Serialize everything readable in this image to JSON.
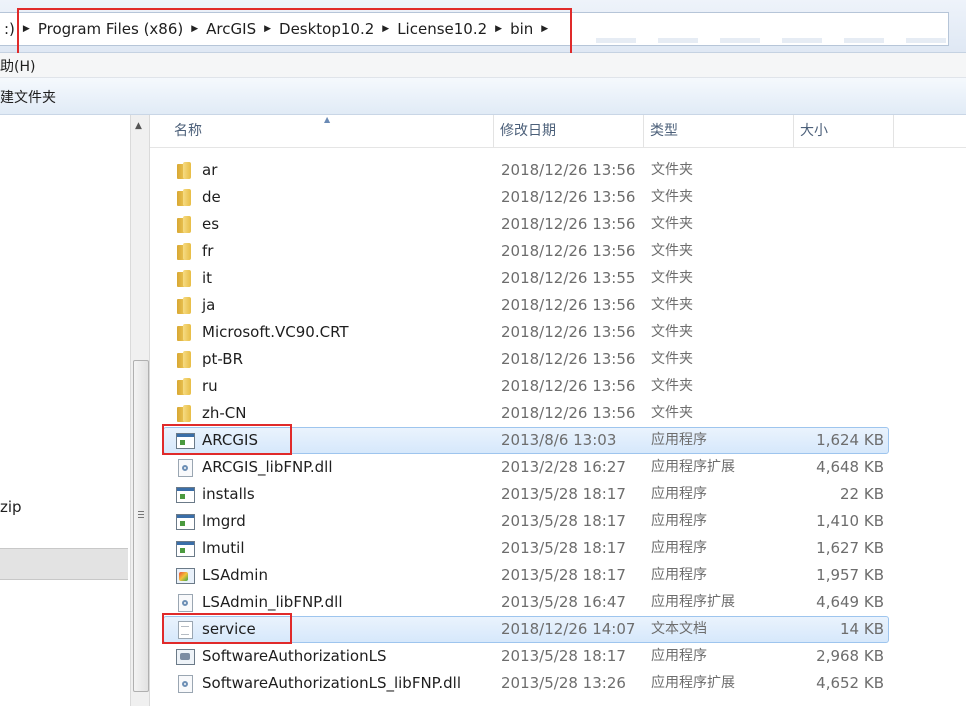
{
  "address": {
    "drive_fragment": ":)",
    "crumbs": [
      "Program Files (x86)",
      "ArcGIS",
      "Desktop10.2",
      "License10.2",
      "bin"
    ]
  },
  "menu": {
    "help_fragment": "助(H)"
  },
  "toolbar": {
    "new_folder_fragment": "建文件夹"
  },
  "nav": {
    "zip_fragment": "zip"
  },
  "columns": {
    "name": "名称",
    "date": "修改日期",
    "type": "类型",
    "size": "大小"
  },
  "files": [
    {
      "name": "ar",
      "date": "2018/12/26 13:56",
      "type": "文件夹",
      "size": "",
      "icon": "folder-icon",
      "kind": "folder"
    },
    {
      "name": "de",
      "date": "2018/12/26 13:56",
      "type": "文件夹",
      "size": "",
      "icon": "folder-icon",
      "kind": "folder"
    },
    {
      "name": "es",
      "date": "2018/12/26 13:56",
      "type": "文件夹",
      "size": "",
      "icon": "folder-icon",
      "kind": "folder"
    },
    {
      "name": "fr",
      "date": "2018/12/26 13:56",
      "type": "文件夹",
      "size": "",
      "icon": "folder-icon",
      "kind": "folder"
    },
    {
      "name": "it",
      "date": "2018/12/26 13:55",
      "type": "文件夹",
      "size": "",
      "icon": "folder-icon",
      "kind": "folder"
    },
    {
      "name": "ja",
      "date": "2018/12/26 13:56",
      "type": "文件夹",
      "size": "",
      "icon": "folder-icon",
      "kind": "folder"
    },
    {
      "name": "Microsoft.VC90.CRT",
      "date": "2018/12/26 13:56",
      "type": "文件夹",
      "size": "",
      "icon": "folder-icon",
      "kind": "folder"
    },
    {
      "name": "pt-BR",
      "date": "2018/12/26 13:56",
      "type": "文件夹",
      "size": "",
      "icon": "folder-icon",
      "kind": "folder"
    },
    {
      "name": "ru",
      "date": "2018/12/26 13:56",
      "type": "文件夹",
      "size": "",
      "icon": "folder-icon",
      "kind": "folder"
    },
    {
      "name": "zh-CN",
      "date": "2018/12/26 13:56",
      "type": "文件夹",
      "size": "",
      "icon": "folder-icon",
      "kind": "folder"
    },
    {
      "name": "ARCGIS",
      "date": "2013/8/6 13:03",
      "type": "应用程序",
      "size": "1,624 KB",
      "icon": "application-icon",
      "kind": "exe",
      "selected": true,
      "highlighted": true
    },
    {
      "name": "ARCGIS_libFNP.dll",
      "date": "2013/2/28 16:27",
      "type": "应用程序扩展",
      "size": "4,648 KB",
      "icon": "dll-icon",
      "kind": "dll"
    },
    {
      "name": "installs",
      "date": "2013/5/28 18:17",
      "type": "应用程序",
      "size": "22 KB",
      "icon": "application-icon",
      "kind": "exe"
    },
    {
      "name": "lmgrd",
      "date": "2013/5/28 18:17",
      "type": "应用程序",
      "size": "1,410 KB",
      "icon": "application-icon",
      "kind": "exe"
    },
    {
      "name": "lmutil",
      "date": "2013/5/28 18:17",
      "type": "应用程序",
      "size": "1,627 KB",
      "icon": "application-icon",
      "kind": "exe"
    },
    {
      "name": "LSAdmin",
      "date": "2013/5/28 18:17",
      "type": "应用程序",
      "size": "1,957 KB",
      "icon": "lsadmin-icon",
      "kind": "admin"
    },
    {
      "name": "LSAdmin_libFNP.dll",
      "date": "2013/5/28 16:47",
      "type": "应用程序扩展",
      "size": "4,649 KB",
      "icon": "dll-icon",
      "kind": "dll"
    },
    {
      "name": "service",
      "date": "2018/12/26 14:07",
      "type": "文本文档",
      "size": "14 KB",
      "icon": "text-document-icon",
      "kind": "txt",
      "selected": true,
      "highlighted": true
    },
    {
      "name": "SoftwareAuthorizationLS",
      "date": "2013/5/28 18:17",
      "type": "应用程序",
      "size": "2,968 KB",
      "icon": "software-authorization-icon",
      "kind": "swauth"
    },
    {
      "name": "SoftwareAuthorizationLS_libFNP.dll",
      "date": "2013/5/28 13:26",
      "type": "应用程序扩展",
      "size": "4,652 KB",
      "icon": "dll-icon",
      "kind": "dll"
    }
  ],
  "colors": {
    "annotation_red": "#e02a2a",
    "selection_border": "#9ec5ee",
    "header_text": "#4c607a"
  }
}
